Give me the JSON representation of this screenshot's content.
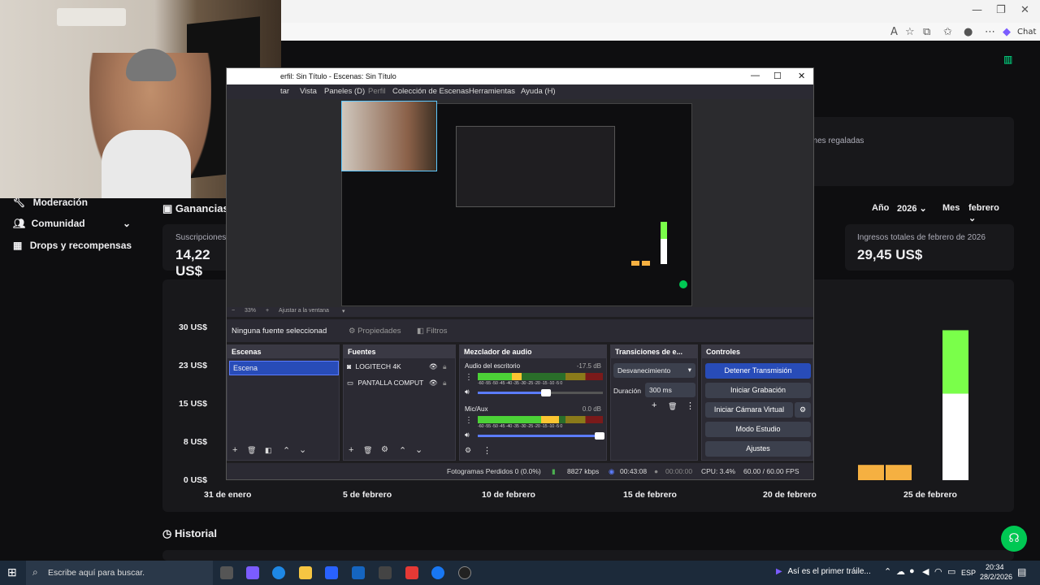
{
  "browser": {
    "chat_label": "Chat",
    "icons": [
      "minimize-icon",
      "restore-icon",
      "close-icon",
      "read-aloud-icon",
      "favorite-icon",
      "extensions-icon",
      "favorites-bar-icon",
      "profile-icon",
      "more-icon",
      "copilot-icon"
    ]
  },
  "sidebar": {
    "items": [
      {
        "label": "Moderación",
        "icon": "wrench-icon"
      },
      {
        "label": "Comunidad",
        "icon": "people-icon"
      },
      {
        "label": "Drops y recompensas",
        "icon": "gift-icon"
      }
    ]
  },
  "earnings": {
    "title": "Ganancias",
    "year_label": "Año",
    "year_value": "2026",
    "month_label": "Mes",
    "month_value": "febrero",
    "subs_label": "Suscripciones",
    "subs_value": "14,22 US$",
    "gifted_fragment": "ones regaladas",
    "total_label": "Ingresos totales de febrero de 2026",
    "total_value": "29,45 US$"
  },
  "history": {
    "title": "Historial"
  },
  "chart_data": {
    "type": "bar",
    "title": "",
    "xlabel": "",
    "ylabel": "",
    "y_ticks": [
      "30 US$",
      "23 US$",
      "15 US$",
      "8 US$",
      "0 US$"
    ],
    "x_ticks": [
      "31 de enero",
      "5 de febrero",
      "10 de febrero",
      "15 de febrero",
      "20 de febrero",
      "25 de febrero"
    ],
    "ylim": [
      0,
      30
    ],
    "bars": [
      {
        "day": "24 de febrero",
        "value": 1.2,
        "color": "#f5b041"
      },
      {
        "day": "25 de febrero",
        "value": 1.2,
        "color": "#f5b041"
      },
      {
        "day": "27 de febrero",
        "value": 29.45,
        "stack": [
          {
            "value": 17,
            "color": "#ffffff"
          },
          {
            "value": 12.45,
            "color": "#7aff4a"
          }
        ]
      }
    ]
  },
  "obs": {
    "title": "erfil: Sin Título - Escenas: Sin Título",
    "menu": [
      "tar",
      "Vista",
      "Paneles (D)",
      "Perfil",
      "Colección de Escenas",
      "Herramientas",
      "Ayuda (H)"
    ],
    "zoom": "33%",
    "fit_label": "Ajustar a la ventana",
    "no_source": "Ninguna fuente seleccionad",
    "properties_label": "Propiedades",
    "filters_label": "Filtros",
    "scenes": {
      "title": "Escenas",
      "items": [
        "Escena"
      ]
    },
    "sources": {
      "title": "Fuentes",
      "items": [
        "LOGITECH 4K",
        "PANTALLA COMPUT"
      ]
    },
    "mixer": {
      "title": "Mezclador de audio",
      "channels": [
        {
          "name": "Audio del escritorio",
          "db": "-17.5 dB",
          "level": 0.35,
          "volume": 0.55
        },
        {
          "name": "Mic/Aux",
          "db": "0.0 dB",
          "level": 0.65,
          "volume": 0.98
        }
      ],
      "scale": "-60 -55 -50 -45 -40 -35 -30 -25 -20 -15 -10 -5 0"
    },
    "transitions": {
      "title": "Transiciones de e...",
      "selected": "Desvanecimiento",
      "duration_label": "Duración",
      "duration_value": "300 ms"
    },
    "controls": {
      "title": "Controles",
      "buttons": [
        "Detener Transmisión",
        "Iniciar Grabación",
        "Iniciar Cámara Virtual",
        "Modo Estudio",
        "Ajustes"
      ]
    },
    "status": {
      "dropped": "Fotogramas Perdidos 0 (0.0%)",
      "bitrate": "8827 kbps",
      "live_time": "00:43:08",
      "rec_time": "00:00:00",
      "cpu": "CPU: 3.4%",
      "fps": "60.00 / 60.00 FPS"
    }
  },
  "taskbar": {
    "search_placeholder": "Escribe aquí para buscar.",
    "media": "Así es el primer tráile...",
    "lang": "ESP",
    "time": "20:34",
    "date": "28/2/2026"
  }
}
